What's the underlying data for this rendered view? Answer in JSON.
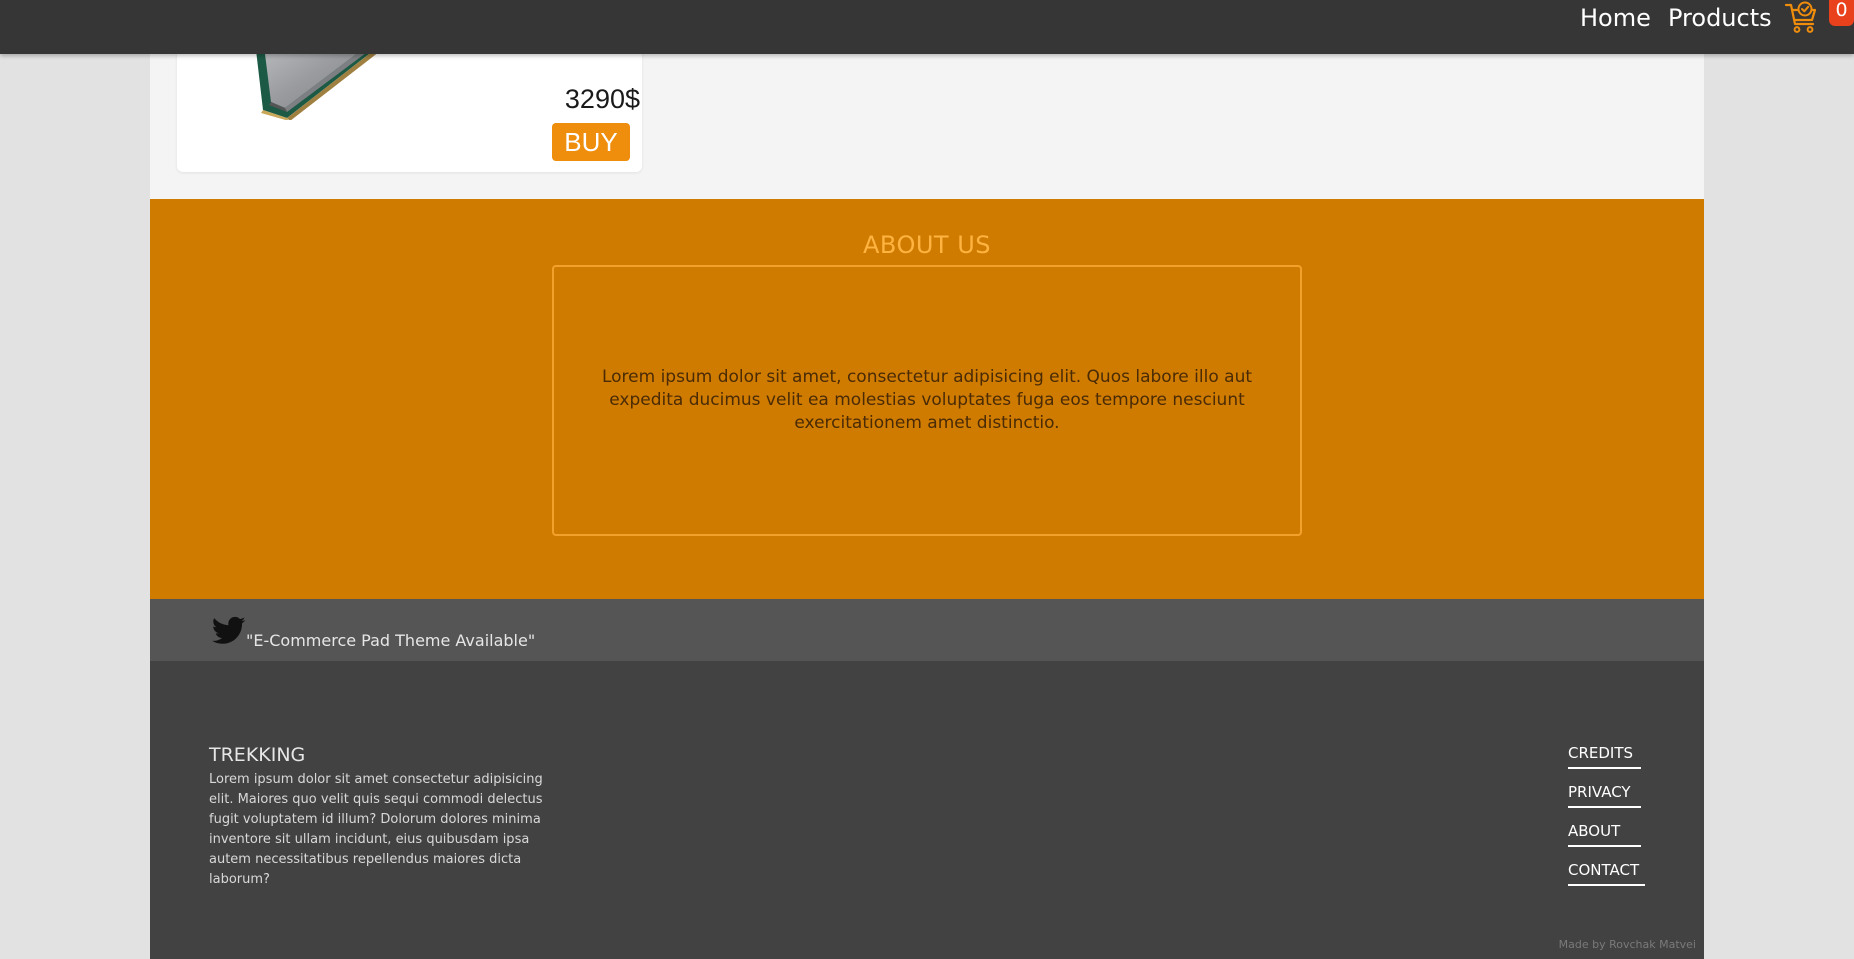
{
  "nav": {
    "links": [
      {
        "label": "Home"
      },
      {
        "label": "Products"
      }
    ],
    "cart": {
      "icon": "shopping-cart-icon",
      "count": "0",
      "accent": "#ef8d0c",
      "badge_color": "#e8411c"
    }
  },
  "product": {
    "price": "3290$",
    "buy_label": "BUY",
    "image": "cpu-processor-image"
  },
  "about": {
    "title": "ABOUT US",
    "text": "Lorem ipsum dolor sit amet, consectetur adipisicing elit. Quos labore illo aut expedita ducimus velit ea molestias voluptates fuga eos tempore nesciunt exercitationem amet distinctio.",
    "background": "#cf7b00"
  },
  "tagline": {
    "icon": "twitter-icon",
    "text": "\"E-Commerce Pad Theme Available\""
  },
  "footer": {
    "title": "TREKKING",
    "description": "Lorem ipsum dolor sit amet consectetur adipisicing elit. Maiores quo velit quis sequi commodi delectus fugit voluptatem id illum? Dolorum dolores minima inventore sit ullam incidunt, eius quibusdam ipsa autem necessitatibus repellendus maiores dicta laborum?",
    "links": [
      {
        "label": "CREDITS"
      },
      {
        "label": "PRIVACY"
      },
      {
        "label": "ABOUT"
      },
      {
        "label": "CONTACT"
      }
    ],
    "made_by": "Made by Rovchak Matvei"
  }
}
